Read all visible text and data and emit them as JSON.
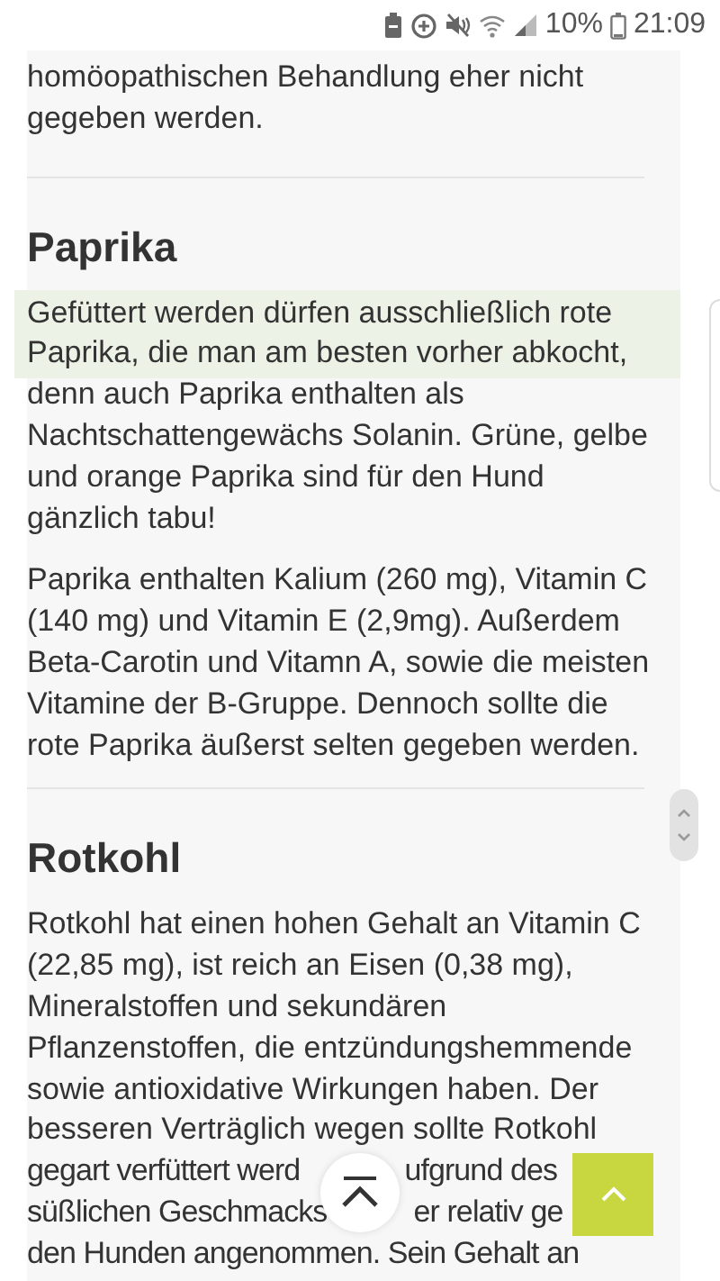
{
  "status_bar": {
    "battery_text": "10%",
    "time": "21:09"
  },
  "sections": [
    {
      "paragraphs": [
        {
          "highlighted": false,
          "lines": [
            "homöopathischen Behandlung eher nicht",
            "gegeben werden."
          ]
        }
      ]
    },
    {
      "heading": "Paprika",
      "paragraphs": [
        {
          "highlighted": true,
          "lines": [
            "Gefüttert werden dürfen ausschließlich rote",
            "Paprika, die man am besten vorher abkocht,",
            "denn auch Paprika enthalten als",
            "Nachtschattengewächs Solanin. Grüne, gelbe",
            "und orange Paprika sind für den Hund",
            "gänzlich tabu!"
          ]
        },
        {
          "highlighted": false,
          "lines": [
            "Paprika enthalten Kalium (260 mg), Vitamin C",
            "(140 mg) und Vitamin E (2,9mg). Außerdem",
            "Beta-Carotin und Vitamn A, sowie die meisten",
            "Vitamine der B-Gruppe. Dennoch sollte die",
            "rote Paprika äußerst selten gegeben werden."
          ]
        }
      ]
    },
    {
      "heading": "Rotkohl",
      "paragraphs": [
        {
          "highlighted": false,
          "lines": [
            "Rotkohl hat einen hohen Gehalt an Vitamin C",
            "(22,85 mg), ist reich an Eisen (0,38 mg),",
            "Mineralstoffen und sekundären",
            "Pflanzenstoffen, die entzündungshemmende",
            "sowie antioxidative Wirkungen haben. Der",
            "besseren Verträglich wegen sollte Rotkohl"
          ]
        },
        {
          "kind": "fragments",
          "lines": [
            [
              "gegart verfüttert werd",
              "ufgrund des"
            ],
            [
              "süßlichen Geschmacks",
              "er relativ ge"
            ],
            [
              "den Hunden angenommen. Sein Gehalt an"
            ]
          ]
        }
      ]
    }
  ]
}
